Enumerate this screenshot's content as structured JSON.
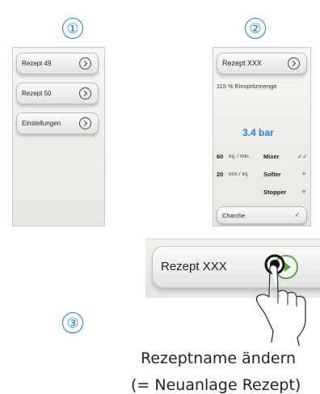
{
  "steps": [
    "①",
    "②",
    "③"
  ],
  "screen1": {
    "items": [
      {
        "label": "Rezept 49"
      },
      {
        "label": "Rezept 50"
      },
      {
        "label": "Einstellungen"
      }
    ]
  },
  "screen2": {
    "recipe_label": "Rezept XXX",
    "injection_amount": "115 % Einspritzmenge",
    "pressure": "3.4 bar",
    "rows": [
      {
        "value": "60",
        "unit": "Inj. / min",
        "label": "Mixer",
        "status": "✓✓"
      },
      {
        "value": "20",
        "unit": "mm / Inj.",
        "label": "Softer",
        "status": "×"
      },
      {
        "value": "",
        "unit": "",
        "label": "Stopper",
        "status": "×"
      }
    ],
    "batch_label": "Charche",
    "batch_status": "✓"
  },
  "zoom": {
    "recipe_label": "Rezept XXX"
  },
  "caption": {
    "line1": "Rezeptname ändern",
    "line2": "(= Neuanlage Rezept)"
  },
  "colors": {
    "accent": "#1f80c8",
    "pressure": "#2a7fd6",
    "check": "#3a9a3a",
    "cross": "#d04040",
    "play": "#5aa83a"
  }
}
